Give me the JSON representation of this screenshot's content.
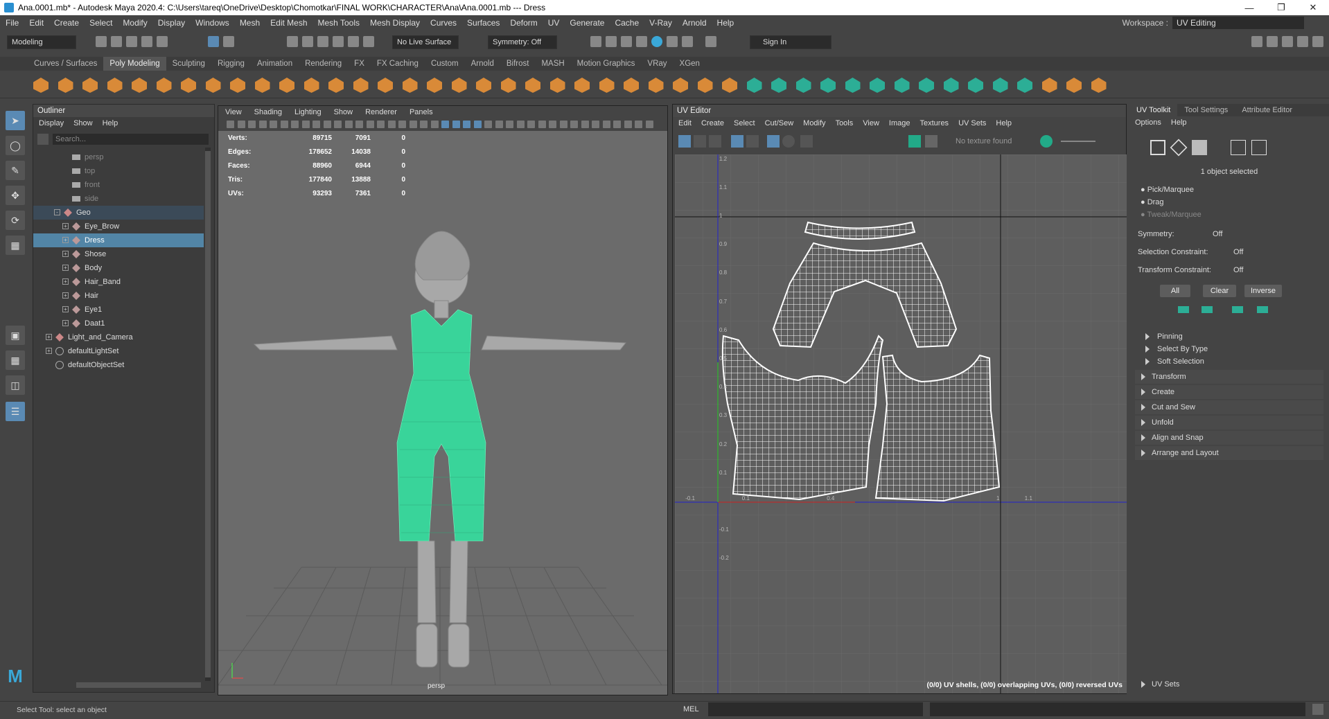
{
  "titlebar": {
    "title": "Ana.0001.mb* - Autodesk Maya 2020.4: C:\\Users\\tareq\\OneDrive\\Desktop\\Chomotkar\\FINAL WORK\\CHARACTER\\Ana\\Ana.0001.mb  ---  Dress"
  },
  "menu": [
    "File",
    "Edit",
    "Create",
    "Select",
    "Modify",
    "Display",
    "Windows",
    "Mesh",
    "Edit Mesh",
    "Mesh Tools",
    "Mesh Display",
    "Curves",
    "Surfaces",
    "Deform",
    "UV",
    "Generate",
    "Cache",
    "V-Ray",
    "Arnold",
    "Help"
  ],
  "workspace": {
    "label": "Workspace :",
    "value": "UV Editing"
  },
  "status": {
    "mode": "Modeling",
    "live_surface": "No Live Surface",
    "symmetry": "Symmetry: Off",
    "sign_in": "Sign In"
  },
  "shelf_tabs": [
    "Curves / Surfaces",
    "Poly Modeling",
    "Sculpting",
    "Rigging",
    "Animation",
    "Rendering",
    "FX",
    "FX Caching",
    "Custom",
    "Arnold",
    "Bifrost",
    "MASH",
    "Motion Graphics",
    "VRay",
    "XGen"
  ],
  "outliner": {
    "title": "Outliner",
    "menu": [
      "Display",
      "Show",
      "Help"
    ],
    "search_placeholder": "Search...",
    "items": [
      "persp",
      "top",
      "front",
      "side",
      "Geo",
      "Eye_Brow",
      "Dress",
      "Shose",
      "Body",
      "Hair_Band",
      "Hair",
      "Eye1",
      "Daat1",
      "Light_and_Camera",
      "defaultLightSet",
      "defaultObjectSet"
    ]
  },
  "viewport": {
    "menu": [
      "View",
      "Shading",
      "Lighting",
      "Show",
      "Renderer",
      "Panels"
    ],
    "hud": [
      {
        "k": "Verts:",
        "a": "89715",
        "b": "7091",
        "c": "0"
      },
      {
        "k": "Edges:",
        "a": "178652",
        "b": "14038",
        "c": "0"
      },
      {
        "k": "Faces:",
        "a": "88960",
        "b": "6944",
        "c": "0"
      },
      {
        "k": "Tris:",
        "a": "177840",
        "b": "13888",
        "c": "0"
      },
      {
        "k": "UVs:",
        "a": "93293",
        "b": "7361",
        "c": "0"
      }
    ],
    "camera": "persp"
  },
  "uv_editor": {
    "title": "UV Editor",
    "menu": [
      "Edit",
      "Create",
      "Select",
      "Cut/Sew",
      "Modify",
      "Tools",
      "View",
      "Image",
      "Textures",
      "UV Sets",
      "Help"
    ],
    "texture": "No texture found",
    "status": "(0/0) UV shells, (0/0) overlapping UVs, (0/0) reversed UVs",
    "v_ticks": [
      "1.2",
      "1.1",
      "1",
      "0.9",
      "0.8",
      "0.7",
      "0.6",
      "0.5",
      "0.4",
      "0.3",
      "0.2",
      "0.1",
      "-0.1",
      "-0.2"
    ],
    "u_ticks": [
      "-0.1",
      "0.1",
      "0.4",
      "1",
      "1.1"
    ]
  },
  "uv_toolkit": {
    "tabs": [
      "UV Toolkit",
      "Tool Settings",
      "Attribute Editor"
    ],
    "menu": [
      "Options",
      "Help"
    ],
    "selected": "1 object selected",
    "modes": [
      "Pick/Marquee",
      "Drag",
      "Tweak/Marquee"
    ],
    "symmetry": {
      "label": "Symmetry:",
      "value": "Off"
    },
    "sel_constraint": {
      "label": "Selection Constraint:",
      "value": "Off"
    },
    "xf_constraint": {
      "label": "Transform Constraint:",
      "value": "Off"
    },
    "buttons": [
      "All",
      "Clear",
      "Inverse"
    ],
    "subsections": [
      "Pinning",
      "Select By Type",
      "Soft Selection"
    ],
    "sections": [
      "Transform",
      "Create",
      "Cut and Sew",
      "Unfold",
      "Align and Snap",
      "Arrange and Layout"
    ],
    "uv_sets": "UV Sets"
  },
  "helpline": {
    "text": "Select Tool: select an object",
    "mel": "MEL"
  },
  "colors": {
    "accent": "#5285a6",
    "wire": "#40e0a0",
    "shelf": "#d98a38"
  }
}
